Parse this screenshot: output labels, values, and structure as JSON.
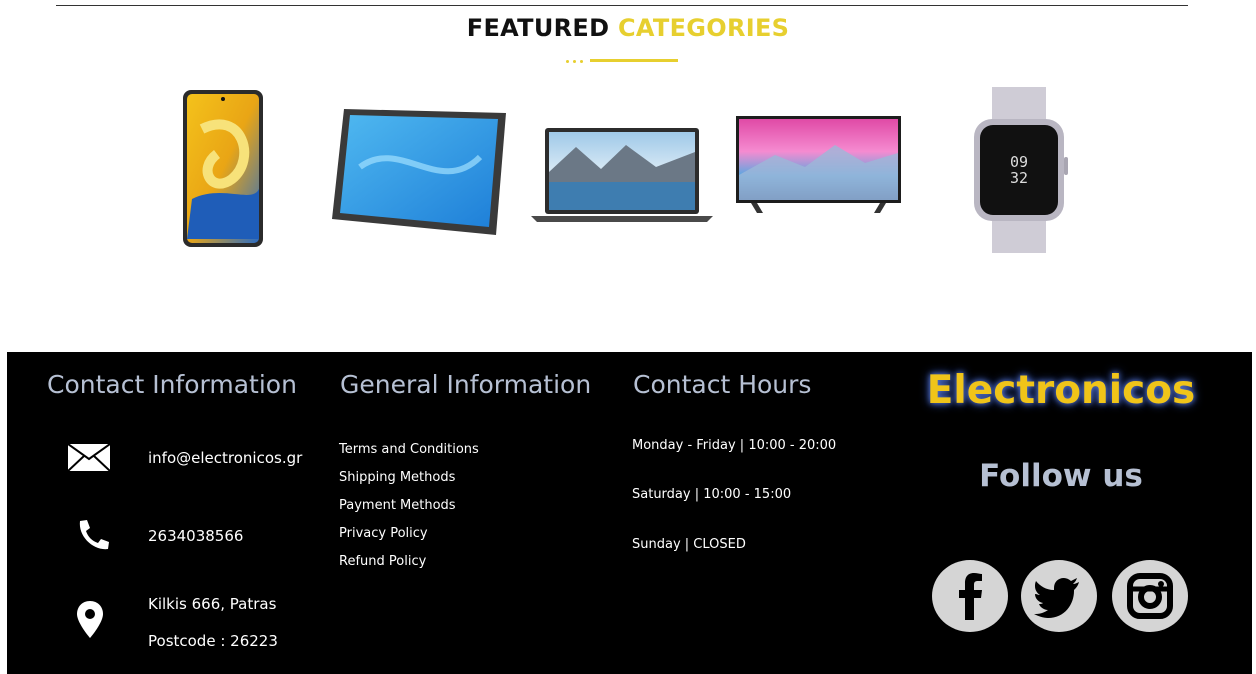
{
  "featured": {
    "title_part1": "FEATURED",
    "title_part2": "CATEGORIES",
    "accent_color": "#e7cf2f",
    "categories": [
      {
        "name": "phone"
      },
      {
        "name": "tablet"
      },
      {
        "name": "laptop"
      },
      {
        "name": "tv"
      },
      {
        "name": "smartwatch"
      }
    ]
  },
  "footer": {
    "contact": {
      "heading": "Contact Information",
      "email": "info@electronicos.gr",
      "phone": "2634038566",
      "address": "Kilkis 666, Patras",
      "postcode": "Postcode : 26223"
    },
    "general": {
      "heading": "General Information",
      "links": [
        "Terms and Conditions",
        "Shipping Methods",
        "Payment Methods",
        "Privacy Policy",
        "Refund Policy"
      ]
    },
    "hours": {
      "heading": "Contact Hours",
      "lines": [
        "Monday - Friday | 10:00 - 20:00",
        "Saturday | 10:00 - 15:00",
        "Sunday | CLOSED"
      ]
    },
    "brand": "Electronicos",
    "follow": "Follow us",
    "social": [
      {
        "icon": "facebook-icon"
      },
      {
        "icon": "twitter-icon"
      },
      {
        "icon": "instagram-icon"
      }
    ]
  },
  "colors": {
    "footer_bg": "#000000",
    "heading": "#b6c0d3",
    "brand": "#f0c419"
  }
}
